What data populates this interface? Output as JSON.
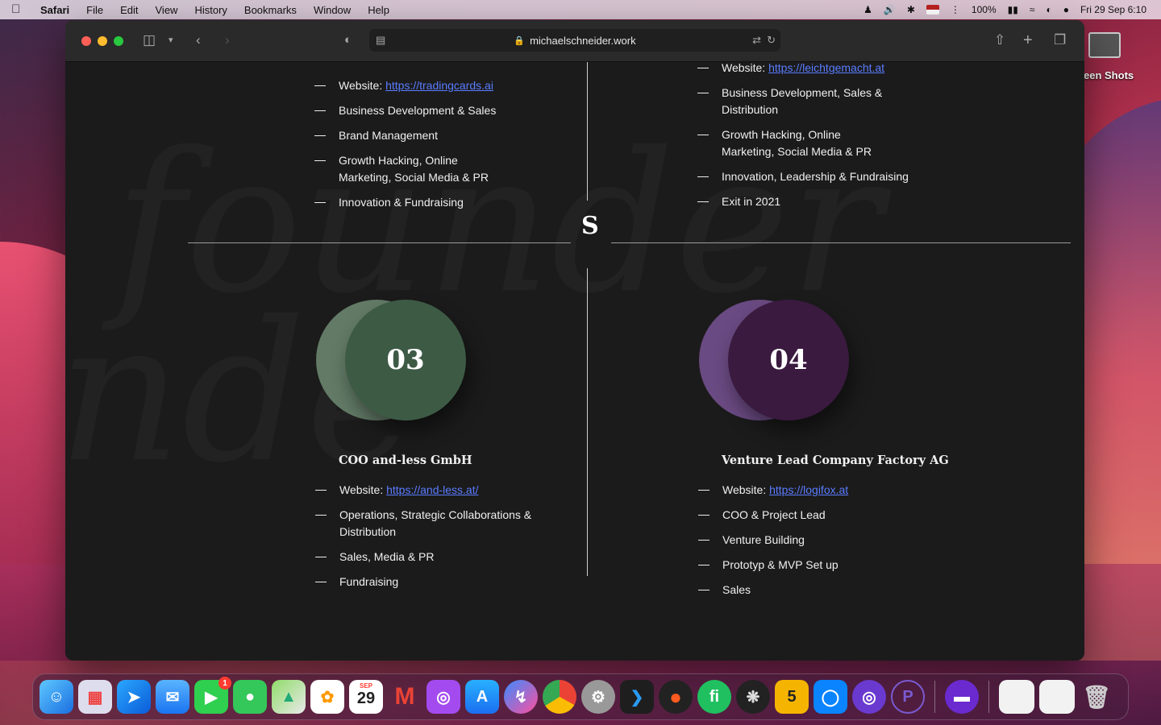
{
  "menubar": {
    "app": "Safari",
    "items": [
      "File",
      "Edit",
      "View",
      "History",
      "Bookmarks",
      "Window",
      "Help"
    ],
    "battery": "100%",
    "datetime": "Fri 29 Sep  6:10"
  },
  "browser": {
    "url": "michaelschneider.work"
  },
  "desktop": {
    "screenshot_folder_label": "een Shots"
  },
  "page": {
    "watermark_top": "founder",
    "watermark_bottom": "nde",
    "center_mark": "S",
    "top_left_items": [
      {
        "prefix": "Website: ",
        "link": "https://tradingcards.ai"
      },
      {
        "text": "Business Development & Sales"
      },
      {
        "text": "Brand Management"
      },
      {
        "text": "Growth Hacking, Online Marketing, Social Media & PR"
      },
      {
        "text": "Innovation & Fundraising"
      }
    ],
    "top_right_items": [
      {
        "prefix": "Website: ",
        "link": "https://leichtgemacht.at"
      },
      {
        "text": "Business Development, Sales & Distribution"
      },
      {
        "text": "Growth Hacking, Online Marketing, Social Media & PR"
      },
      {
        "text": "Innovation, Leadership & Fundraising"
      },
      {
        "text": "Exit in 2021"
      }
    ],
    "card3": {
      "number": "03",
      "title": "COO and-less GmbH",
      "colors": {
        "back": "#627a66",
        "front": "#3d5a45"
      },
      "items": [
        {
          "prefix": "Website: ",
          "link": "https://and-less.at/"
        },
        {
          "text": "Operations, Strategic Collaborations & Distribution"
        },
        {
          "text": "Sales, Media & PR"
        },
        {
          "text": "Fundraising"
        }
      ]
    },
    "card4": {
      "number": "04",
      "title": "Venture Lead Company Factory AG",
      "colors": {
        "back": "#6a4a82",
        "front": "#3a1a3f"
      },
      "items": [
        {
          "prefix": "Website: ",
          "link": "https://logifox.at"
        },
        {
          "text": "COO & Project Lead"
        },
        {
          "text": "Venture Building"
        },
        {
          "text": "Prototyp & MVP Set up"
        },
        {
          "text": "Sales"
        }
      ]
    }
  },
  "dock": {
    "facetime_badge": "1",
    "calendar_month": "SEP",
    "calendar_day": "29",
    "app_5_label": "5"
  }
}
